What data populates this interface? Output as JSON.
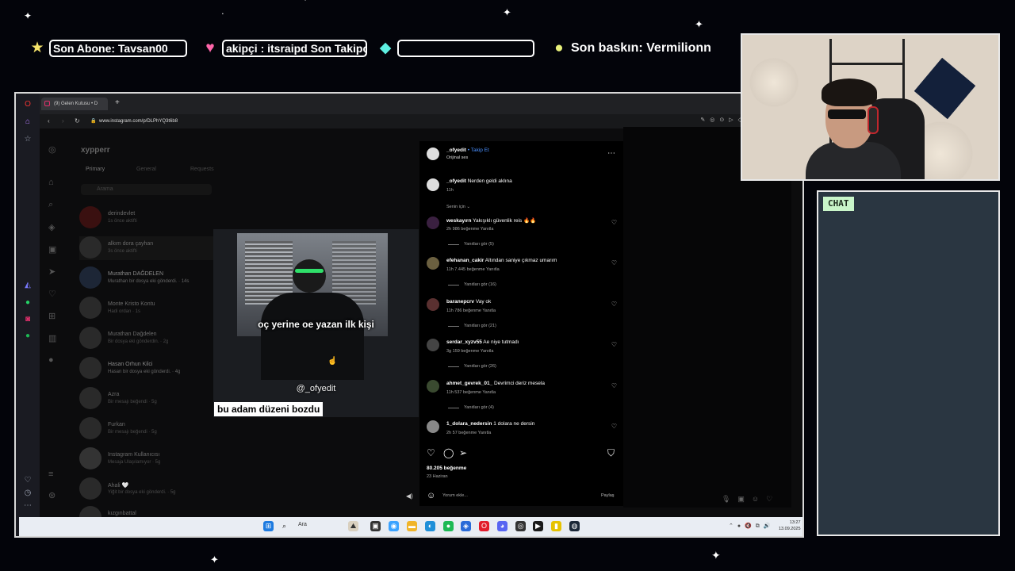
{
  "overlay": {
    "subscriber": {
      "icon": "star-icon",
      "text": "Son Abone: Tavsan00"
    },
    "follower": {
      "icon": "heart-icon",
      "text": "akipçi : itsraipd    Son Takipç"
    },
    "donation": {
      "icon": "diamond-icon",
      "text": ""
    },
    "raid": {
      "icon": "coin-icon",
      "text": "Son baskın: Vermilionn"
    }
  },
  "browser": {
    "tab_title": "(9) Gelen Kutusu • D",
    "url": "www.instagram.com/p/DLPhYQ3t6b8"
  },
  "instagram": {
    "account": "xypperr",
    "dm_tabs": [
      "Primary",
      "General",
      "Requests"
    ],
    "search_placeholder": "Arama",
    "conversations": [
      {
        "name": "derindevlet",
        "sub": "1s önce aktifti"
      },
      {
        "name": "alkım dora çayhan",
        "sub": "3s önce aktifti"
      },
      {
        "name": "Murathan DAĞDELEN",
        "sub": "Murathan bir dosya eki gönderdi. · 14s"
      },
      {
        "name": "Monte Kristo Kontu",
        "sub": "Hadi ordan · 1s"
      },
      {
        "name": "Murathan Dağdelen",
        "sub": "Bir dosya eki gönderdin. · 2g"
      },
      {
        "name": "Hasan Orhun Kilci",
        "sub": "Hasan bir dosya eki gönderdi. · 4g"
      },
      {
        "name": "Azra",
        "sub": "Bir mesajı beğendi · 5g"
      },
      {
        "name": "Furkan",
        "sub": "Bir mesajı beğendi · 5g"
      },
      {
        "name": "Instagram Kullanıcısı",
        "sub": "Mesaja Ulaşılamıyor · 5g"
      },
      {
        "name": "Ahali 🤍",
        "sub": "Yiğit bir dosya eki gönderdi. · 5g"
      },
      {
        "name": "kızgınbattal",
        "sub": ""
      }
    ],
    "video": {
      "caption": "oç yerine oe yazan ilk kişi",
      "watermark": "@_ofyedit",
      "label": "bu adam düzeni bozdu"
    },
    "post": {
      "author": "_ofyedit",
      "follow": "• Takip Et",
      "audio": "Orijinal ses",
      "author_caption_user": "_ofyedit",
      "author_caption": "Nerden geldi aklına",
      "author_caption_time": "11h",
      "filter": "Senin için",
      "comments": [
        {
          "user": "weskayırn",
          "text": "Yakışıklı güvenlik reis 🔥🔥",
          "meta": "2h   986 beğenme   Yanıtla",
          "replies": "Yanıtları gör (5)"
        },
        {
          "user": "efehanan_cakir",
          "text": "Altından saniye çıkmaz umarım",
          "meta": "11h   7.445 beğenme   Yanıtla",
          "replies": "Yanıtları gör (16)"
        },
        {
          "user": "baranepcrv",
          "text": "Vay ok",
          "meta": "11h   786 beğenme   Yanıtla",
          "replies": "Yanıtları gör (21)"
        },
        {
          "user": "serdar_xyzv55",
          "text": "Ae niye tutmadı",
          "meta": "3g   159 beğenme   Yanıtla",
          "replies": "Yanıtları gör (26)"
        },
        {
          "user": "ahmet_gevrek_01_",
          "text": "Devrimci deriz mesela",
          "meta": "11h   537 beğenme   Yanıtla",
          "replies": "Yanıtları gör (4)"
        },
        {
          "user": "1_dolara_nedersin",
          "text": "1 dolara ne dersin",
          "meta": "2h   57 beğenme   Yanıtla",
          "replies": ""
        }
      ],
      "likes": "80.205 beğenme",
      "date": "23 Haziran",
      "comment_placeholder": "Yorum ekle...",
      "share": "Paylaş"
    }
  },
  "taskbar": {
    "search": "Ara",
    "time": "13:27",
    "date": "13.09.2025"
  },
  "chat": {
    "label": "CHAT"
  }
}
